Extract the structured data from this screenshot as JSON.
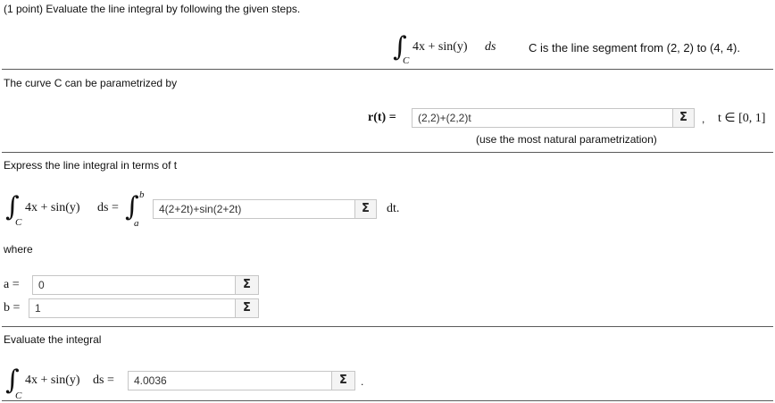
{
  "header": {
    "prompt": "(1 point) Evaluate the line integral by following the given steps."
  },
  "problem": {
    "integrand": "4x + sin(y)",
    "ds": "ds",
    "domain": "C",
    "curve_desc": "C is the line segment from (2, 2) to (4, 4)."
  },
  "step1": {
    "label": "The curve C can be parametrized by",
    "lhs": "r(t) =",
    "answer": "(2,2)+(2,2)t",
    "hint": "(use the most natural parametrization)",
    "comma": ",",
    "t_range": "t ∈ [0, 1]"
  },
  "step2": {
    "label": "Express the line integral in terms of t",
    "lhs_integrand": "4x + sin(y)",
    "lhs_ds": "ds =",
    "upper": "b",
    "lower": "a",
    "answer": "4(2+2t)+sin(2+2t)",
    "dt": "dt.",
    "where": "where",
    "a_label": "a =",
    "a_value": "0",
    "b_label": "b =",
    "b_value": "1"
  },
  "step3": {
    "label": "Evaluate the integral",
    "integrand": "4x + sin(y)",
    "ds": "ds =",
    "answer": "4.0036",
    "period": "."
  },
  "sigma_symbol": "Σ",
  "integral_symbol": "∫"
}
